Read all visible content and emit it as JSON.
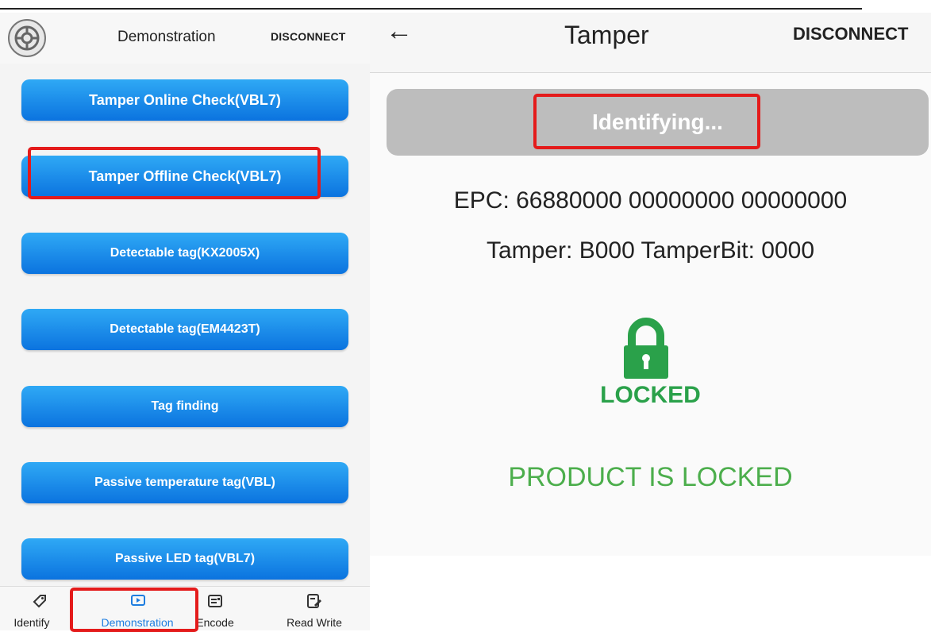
{
  "demo_screen": {
    "title": "Demonstration",
    "disconnect": "DISCONNECT",
    "buttons": [
      "Tamper Online Check(VBL7)",
      "Tamper Offline Check(VBL7)",
      "Detectable tag(KX2005X)",
      "Detectable tag(EM4423T)",
      "Tag finding",
      "Passive temperature tag(VBL)",
      "Passive LED tag(VBL7)"
    ],
    "nav": [
      {
        "label": "Identify",
        "icon": "tag-icon"
      },
      {
        "label": "Demonstration",
        "icon": "play-screen-icon"
      },
      {
        "label": "Encode",
        "icon": "card-icon"
      },
      {
        "label": "Read Write",
        "icon": "edit-icon"
      }
    ]
  },
  "tamper_screen": {
    "title": "Tamper",
    "disconnect": "DISCONNECT",
    "identifying": "Identifying...",
    "epc": "EPC: 66880000 00000000 00000000",
    "tamper_info": "Tamper: B000  TamperBit: 0000",
    "locked_label": "LOCKED",
    "status": "PRODUCT IS LOCKED"
  },
  "colors": {
    "button_top": "#2fa9f5",
    "button_bottom": "#0b73df",
    "highlight": "#e41b1b",
    "locked_green": "#2aa14a"
  }
}
